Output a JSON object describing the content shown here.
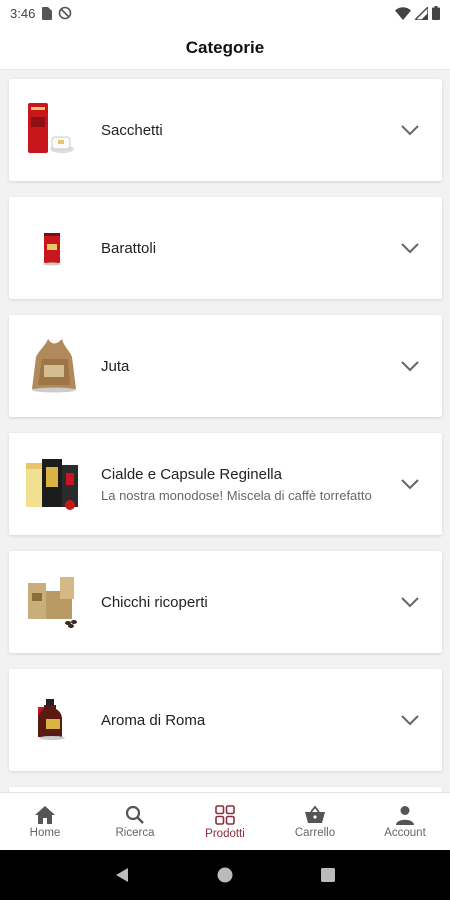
{
  "status_bar": {
    "time": "3:46"
  },
  "header": {
    "title": "Categorie"
  },
  "categories": [
    {
      "name": "Sacchetti",
      "description": "",
      "thumb_icon": "red-coffee-bag-icon"
    },
    {
      "name": "Barattoli",
      "description": "",
      "thumb_icon": "red-coffee-can-icon"
    },
    {
      "name": "Juta",
      "description": "",
      "thumb_icon": "jute-sack-icon"
    },
    {
      "name": "Cialde e Capsule Reginella",
      "description": "La nostra monodose! Miscela di caffè torrefatto",
      "thumb_icon": "coffee-pods-box-icon"
    },
    {
      "name": "Chicchi ricoperti",
      "description": "",
      "thumb_icon": "covered-beans-box-icon"
    },
    {
      "name": "Aroma di Roma",
      "description": "",
      "thumb_icon": "liqueur-bottle-icon"
    }
  ],
  "nav": {
    "home": "Home",
    "search": "Ricerca",
    "products": "Prodotti",
    "cart": "Carrello",
    "account": "Account"
  },
  "colors": {
    "accent": "#8b2d3a",
    "brand_red": "#c8161d"
  }
}
